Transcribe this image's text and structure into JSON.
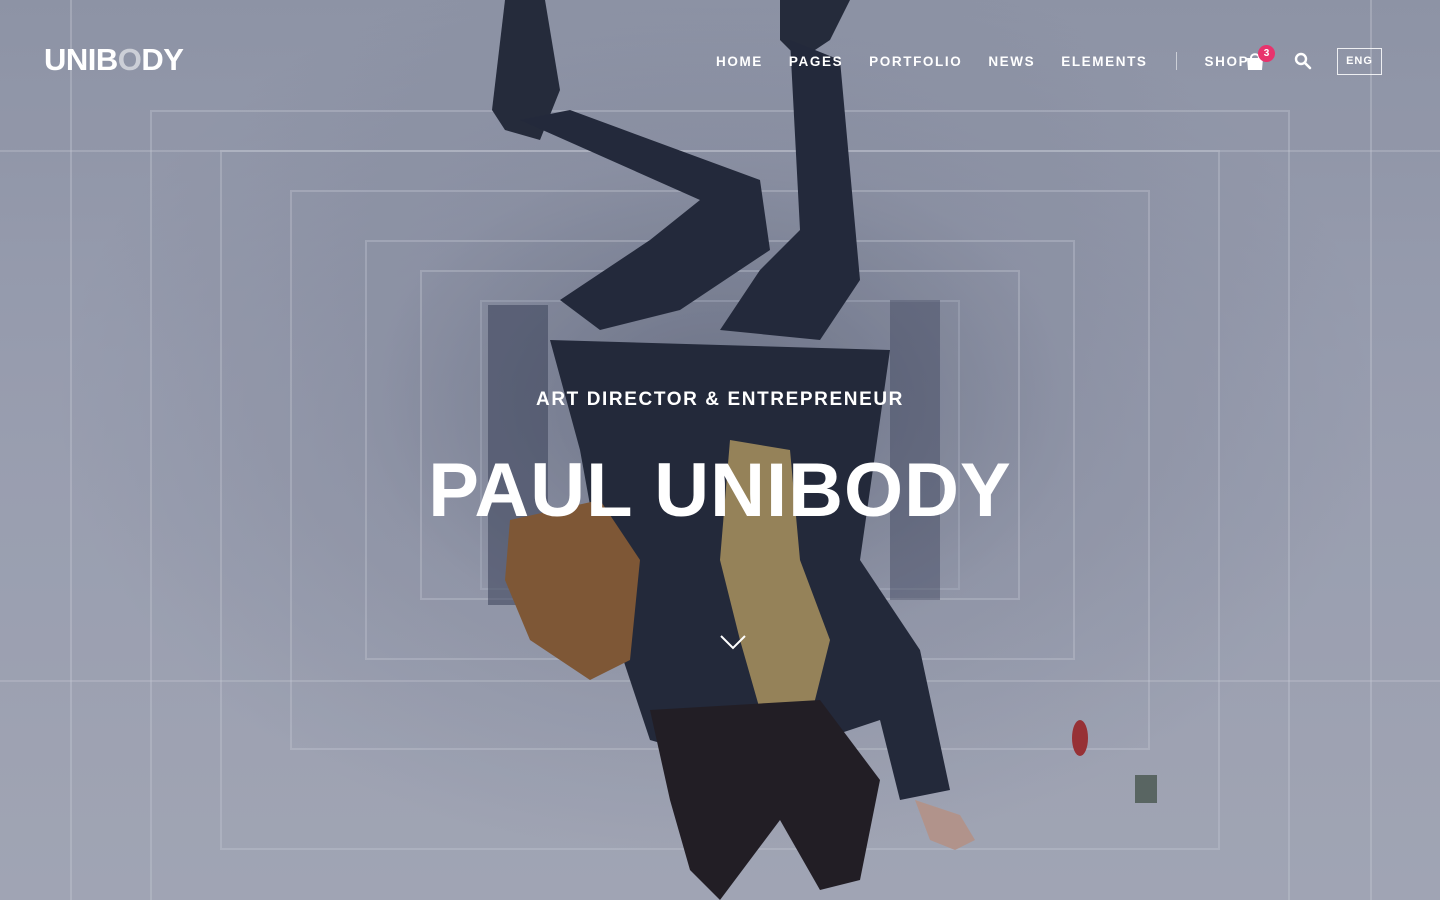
{
  "brand": {
    "logo_prefix": "UNIB",
    "logo_o": "O",
    "logo_suffix": "DY"
  },
  "nav": {
    "items": [
      {
        "label": "HOME"
      },
      {
        "label": "PAGES"
      },
      {
        "label": "PORTFOLIO"
      },
      {
        "label": "NEWS"
      },
      {
        "label": "ELEMENTS"
      }
    ],
    "shop_label": "SHOP",
    "cart_count": "3",
    "language": "ENG"
  },
  "hero": {
    "subtitle": "ART DIRECTOR & ENTREPRENEUR",
    "title": "PAUL UNIBODY"
  },
  "colors": {
    "accent": "#e8336d",
    "text": "#ffffff"
  },
  "icons": {
    "cart": "shopping-bag-icon",
    "search": "search-icon",
    "scroll": "chevron-down-icon"
  }
}
